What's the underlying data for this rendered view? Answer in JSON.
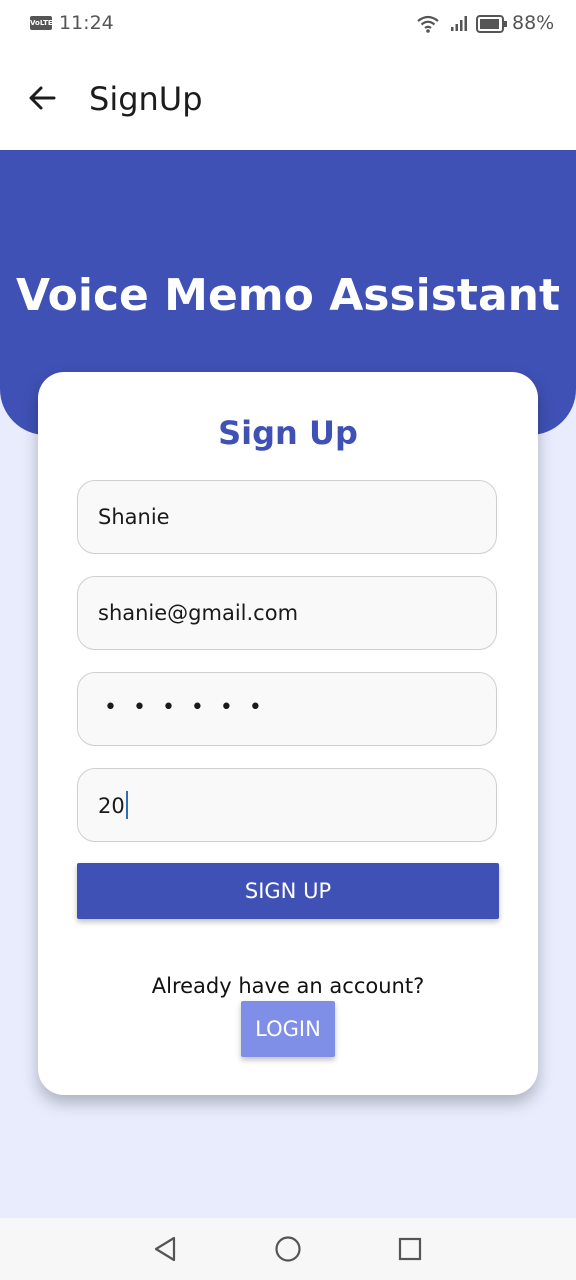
{
  "status_bar": {
    "network_label": "VoLTE",
    "time": "11:24",
    "battery": "88%"
  },
  "app_bar": {
    "title": "SignUp",
    "back_icon": "arrow-left-icon"
  },
  "header": {
    "app_title": "Voice Memo Assistant"
  },
  "form": {
    "title": "Sign Up",
    "name_value": "Shanie",
    "email_value": "shanie@gmail.com",
    "password_value": "••••••",
    "age_value": "20",
    "signup_label": "SIGN UP",
    "already_text": "Already have an account?",
    "login_label": "LOGIN"
  },
  "colors": {
    "primary": "#3f51b5",
    "login_button": "#7f8fe8",
    "background": "#e8ecfd"
  }
}
